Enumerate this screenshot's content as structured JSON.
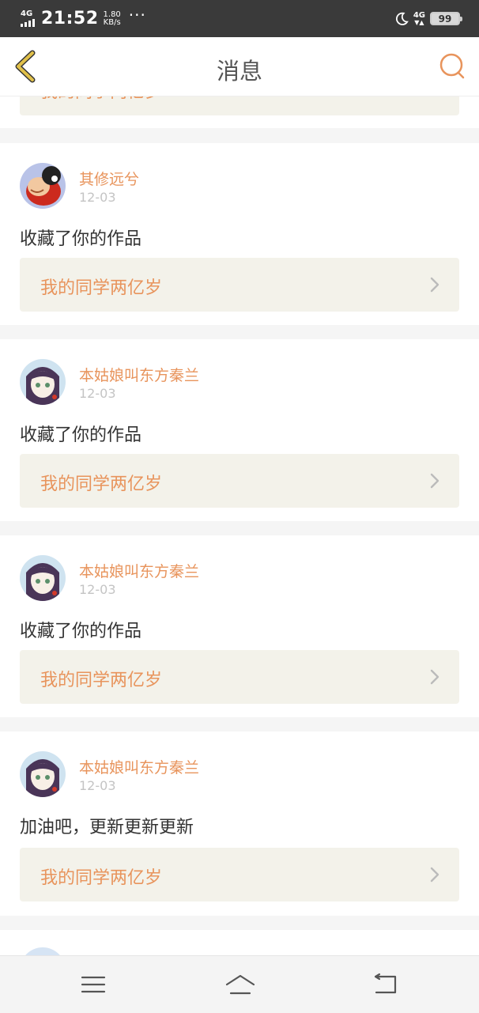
{
  "status_bar": {
    "signal": "4G",
    "time": "21:52",
    "speed_value": "1.80",
    "speed_unit": "KB/s",
    "more": "···",
    "network_right": "4G",
    "battery": "99"
  },
  "header": {
    "title": "消息"
  },
  "partial_top_card": {
    "work_title": "我的同学两亿岁"
  },
  "notifications": [
    {
      "username": "其修远兮",
      "date": "12-03",
      "message": "收藏了你的作品",
      "work_title": "我的同学两亿岁",
      "avatar": "cartoon-boy-avatar"
    },
    {
      "username": "本姑娘叫东方秦兰",
      "date": "12-03",
      "message": "收藏了你的作品",
      "work_title": "我的同学两亿岁",
      "avatar": "anime-girl-avatar"
    },
    {
      "username": "本姑娘叫东方秦兰",
      "date": "12-03",
      "message": "收藏了你的作品",
      "work_title": "我的同学两亿岁",
      "avatar": "anime-girl-avatar"
    },
    {
      "username": "本姑娘叫东方秦兰",
      "date": "12-03",
      "message": "加油吧，更新更新更新",
      "work_title": "我的同学两亿岁",
      "avatar": "anime-girl-avatar"
    }
  ],
  "colors": {
    "accent": "#e8945c",
    "back_icon": "#e0b23a",
    "status_bar": "#3a3a3a",
    "link_bg": "#f3f2ea"
  },
  "icons": {
    "back": "back-chevron-icon",
    "search": "search-icon",
    "chevron": "chevron-right-icon",
    "nav_menu": "menu-icon",
    "nav_home": "home-icon",
    "nav_back": "return-icon"
  }
}
